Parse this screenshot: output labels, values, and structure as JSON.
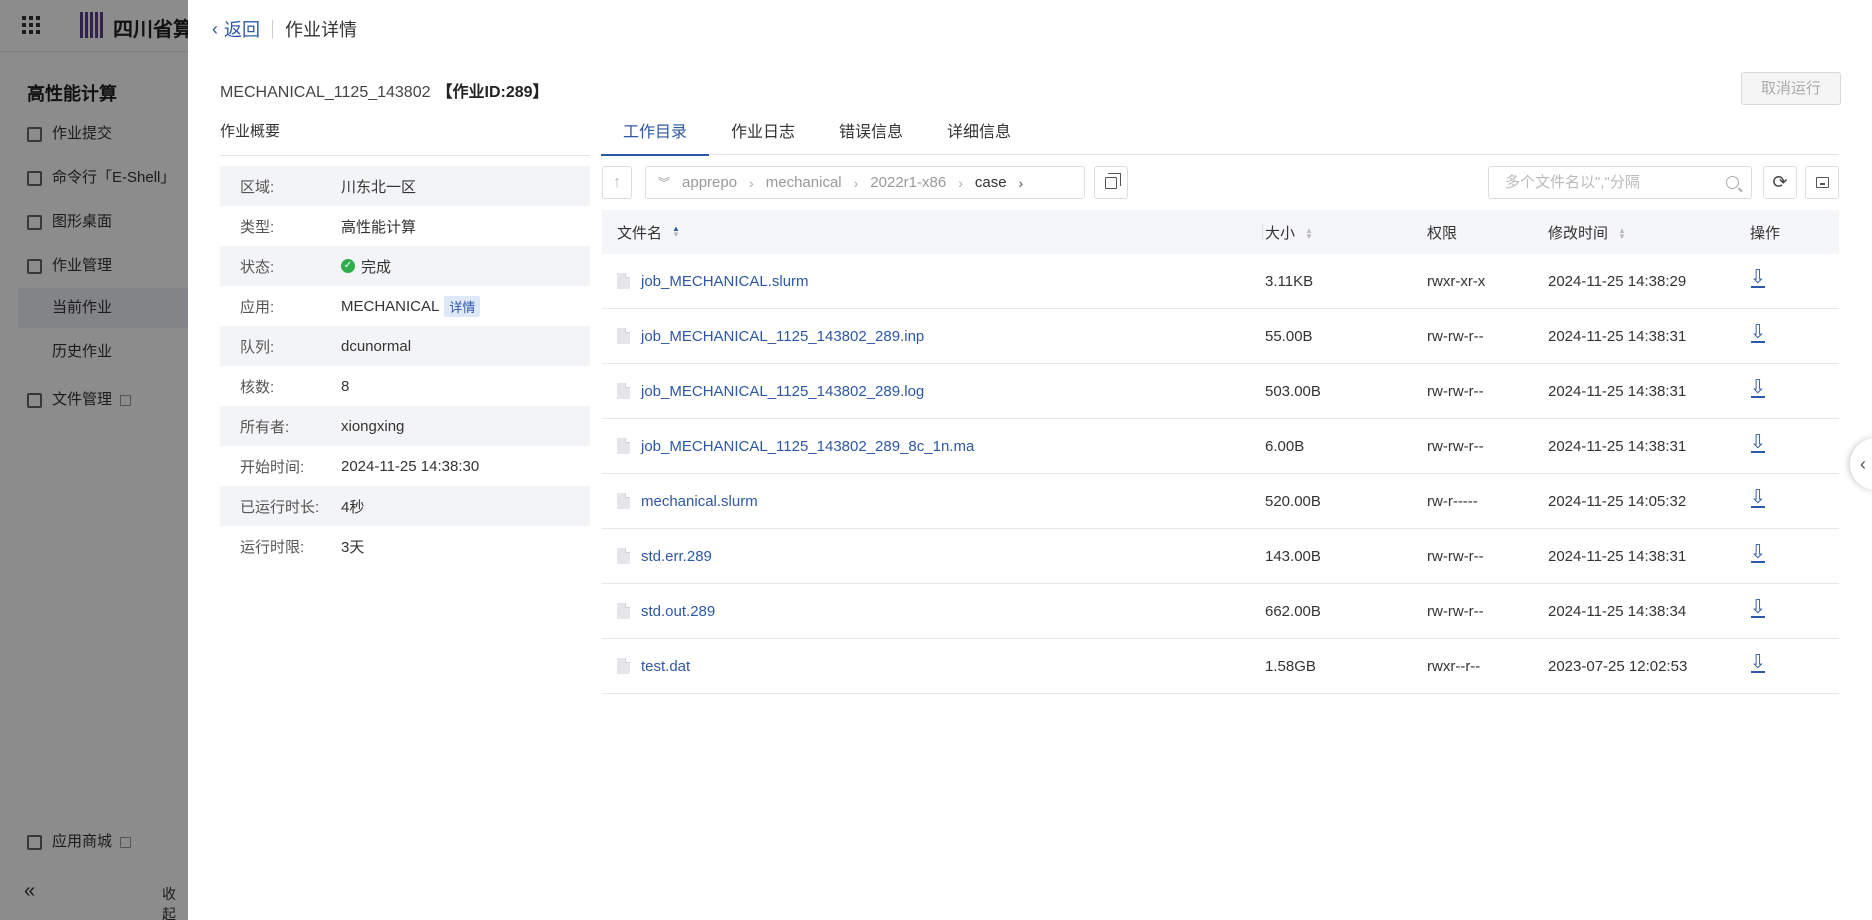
{
  "app": {
    "brand_name": "四川省算",
    "sidebar": {
      "title": "高性能计算",
      "items": [
        {
          "label": "作业提交"
        },
        {
          "label": "命令行「E-Shell」"
        },
        {
          "label": "图形桌面"
        },
        {
          "label": "作业管理"
        },
        {
          "label": "当前作业"
        },
        {
          "label": "历史作业"
        },
        {
          "label": "文件管理"
        }
      ],
      "footer_item": "应用商城",
      "collapse_label": "收起"
    }
  },
  "drawer": {
    "back_label": "返回",
    "title": "作业详情",
    "job_name": "MECHANICAL_1125_143802",
    "job_id": "【作业ID:289】",
    "cancel_label": "取消运行",
    "summary": {
      "title": "作业概要",
      "rows": [
        {
          "key": "区域:",
          "value": "川东北一区"
        },
        {
          "key": "类型:",
          "value": "高性能计算"
        },
        {
          "key": "状态:",
          "value": "完成"
        },
        {
          "key": "应用:",
          "value": "MECHANICAL",
          "tag": "详情"
        },
        {
          "key": "队列:",
          "value": "dcunormal"
        },
        {
          "key": "核数:",
          "value": "8"
        },
        {
          "key": "所有者:",
          "value": "xiongxing"
        },
        {
          "key": "开始时间:",
          "value": "2024-11-25 14:38:30"
        },
        {
          "key": "已运行时长:",
          "value": "4秒"
        },
        {
          "key": "运行时限:",
          "value": "3天"
        }
      ]
    },
    "tabs": [
      {
        "label": "工作目录",
        "active": true
      },
      {
        "label": "作业日志"
      },
      {
        "label": "错误信息"
      },
      {
        "label": "详细信息"
      }
    ],
    "path": [
      "apprepo",
      "mechanical",
      "2022r1-x86",
      "case"
    ],
    "search_placeholder": "多个文件名以\",\"分隔",
    "table": {
      "headers": {
        "name": "文件名",
        "size": "大小",
        "perm": "权限",
        "mtime": "修改时间",
        "action": "操作"
      },
      "rows": [
        {
          "name": "job_MECHANICAL.slurm",
          "size": "3.11KB",
          "perm": "rwxr-xr-x",
          "mtime": "2024-11-25 14:38:29"
        },
        {
          "name": "job_MECHANICAL_1125_143802_289.inp",
          "size": "55.00B",
          "perm": "rw-rw-r--",
          "mtime": "2024-11-25 14:38:31"
        },
        {
          "name": "job_MECHANICAL_1125_143802_289.log",
          "size": "503.00B",
          "perm": "rw-rw-r--",
          "mtime": "2024-11-25 14:38:31"
        },
        {
          "name": "job_MECHANICAL_1125_143802_289_8c_1n.ma",
          "size": "6.00B",
          "perm": "rw-rw-r--",
          "mtime": "2024-11-25 14:38:31"
        },
        {
          "name": "mechanical.slurm",
          "size": "520.00B",
          "perm": "rw-r-----",
          "mtime": "2024-11-25 14:05:32"
        },
        {
          "name": "std.err.289",
          "size": "143.00B",
          "perm": "rw-rw-r--",
          "mtime": "2024-11-25 14:38:31"
        },
        {
          "name": "std.out.289",
          "size": "662.00B",
          "perm": "rw-rw-r--",
          "mtime": "2024-11-25 14:38:34"
        },
        {
          "name": "test.dat",
          "size": "1.58GB",
          "perm": "rwxr--r--",
          "mtime": "2023-07-25 12:02:53"
        }
      ]
    }
  },
  "colors": {
    "accent": "#2d58a6",
    "success": "#2fae4e"
  }
}
